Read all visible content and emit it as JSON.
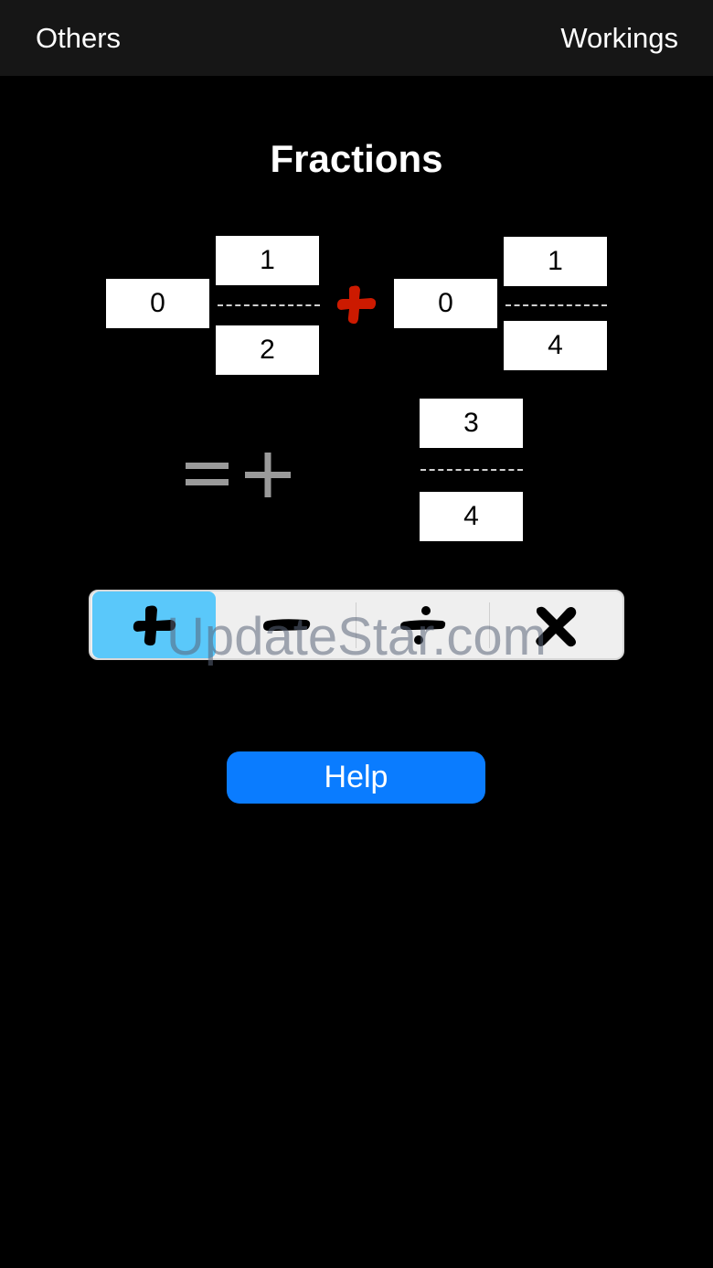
{
  "nav": {
    "left_label": "Others",
    "right_label": "Workings"
  },
  "title": "Fractions",
  "equation": {
    "first": {
      "whole": "0",
      "numerator": "1",
      "denominator": "2"
    },
    "operator": "plus",
    "operator_color": "#cc1a00",
    "second": {
      "whole": "0",
      "numerator": "1",
      "denominator": "4"
    }
  },
  "result": {
    "signs": "=+",
    "numerator": "3",
    "denominator": "4",
    "sign_color": "#9a9a9a"
  },
  "operations": {
    "items": [
      {
        "name": "plus-icon",
        "selected": true
      },
      {
        "name": "minus-icon",
        "selected": false
      },
      {
        "name": "divide-icon",
        "selected": false
      },
      {
        "name": "multiply-icon",
        "selected": false
      }
    ],
    "selected_color": "#5ac8fa"
  },
  "watermark": "UpdateStar.com",
  "help_label": "Help",
  "colors": {
    "background": "#000000",
    "navbar": "#161616",
    "help_button": "#0a7cff"
  }
}
